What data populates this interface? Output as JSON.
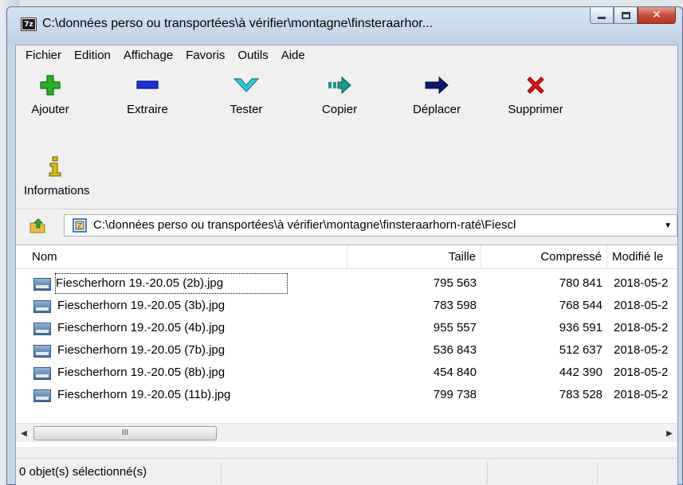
{
  "window": {
    "title": "C:\\données perso ou transportées\\à vérifier\\montagne\\finsteraarhor...",
    "app_icon_text": "7z"
  },
  "menu": [
    "Fichier",
    "Edition",
    "Affichage",
    "Favoris",
    "Outils",
    "Aide"
  ],
  "toolbar": {
    "add": "Ajouter",
    "extract": "Extraire",
    "test": "Tester",
    "copy": "Copier",
    "move": "Déplacer",
    "delete": "Supprimer",
    "info": "Informations"
  },
  "address": {
    "path": "C:\\données perso ou transportées\\à vérifier\\montagne\\finsteraarhorn-raté\\Fiescl"
  },
  "list": {
    "columns": [
      "Nom",
      "Taille",
      "Compressé",
      "Modifié le"
    ],
    "rows": [
      {
        "name": "Fiescherhorn 19.-20.05 (2b).jpg",
        "size": "795 563",
        "packed": "780 841",
        "modified": "2018-05-2"
      },
      {
        "name": "Fiescherhorn 19.-20.05 (3b).jpg",
        "size": "783 598",
        "packed": "768 544",
        "modified": "2018-05-2"
      },
      {
        "name": "Fiescherhorn 19.-20.05 (4b).jpg",
        "size": "955 557",
        "packed": "936 591",
        "modified": "2018-05-2"
      },
      {
        "name": "Fiescherhorn 19.-20.05 (7b).jpg",
        "size": "536 843",
        "packed": "512 637",
        "modified": "2018-05-2"
      },
      {
        "name": "Fiescherhorn 19.-20.05 (8b).jpg",
        "size": "454 840",
        "packed": "442 390",
        "modified": "2018-05-2"
      },
      {
        "name": "Fiescherhorn 19.-20.05 (11b).jpg",
        "size": "799 738",
        "packed": "783 528",
        "modified": "2018-05-2"
      }
    ]
  },
  "scrollbar": {
    "thumb_grip": "III"
  },
  "status": {
    "selection": "0 objet(s) sélectionné(s)"
  },
  "colors": {
    "add": "#22b322",
    "extract": "#1a2fd6",
    "test": "#30c8d8",
    "copy": "#169a8a",
    "move": "#0a1a6e",
    "delete": "#e01010",
    "info": "#d8c000"
  }
}
